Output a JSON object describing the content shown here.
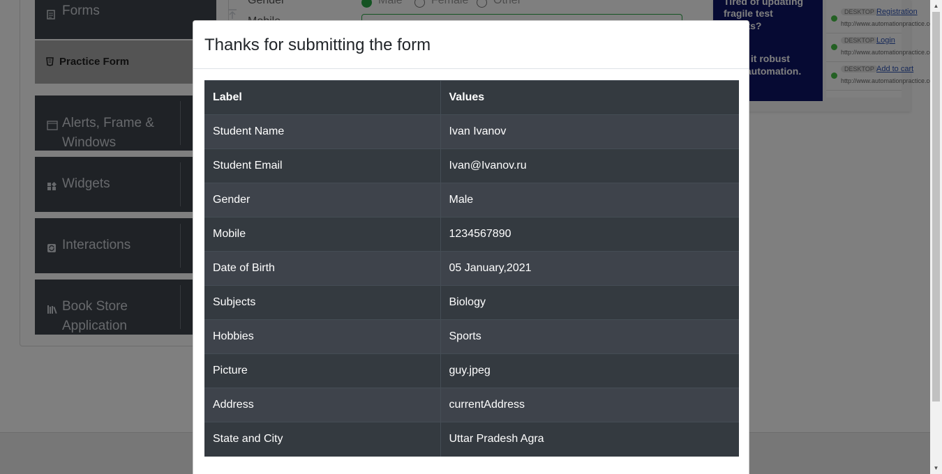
{
  "sidebar": {
    "forms_label": "Forms",
    "practice_label": "Practice Form",
    "alerts_label": "Alerts, Frame & Windows",
    "widgets_label": "Widgets",
    "interactions_label": "Interactions",
    "bookstore_label": "Book Store Application"
  },
  "form_bg": {
    "gender_label": "Gender",
    "mobile_label": "Mobile",
    "gender_options": [
      "Male",
      "Female",
      "Other"
    ]
  },
  "ad": {
    "text_lines": [
      "Tired of updating",
      "fragile test",
      "scripts?",
      "Make it robust",
      "with automation."
    ],
    "items": [
      {
        "tag": "DESKTOP",
        "link": "Registration",
        "url": "http://www.automationpractice.com"
      },
      {
        "tag": "DESKTOP",
        "link": "Login",
        "url": "http://www.automationpractice.com"
      },
      {
        "tag": "DESKTOP",
        "link": "Add to cart",
        "url": "http://www.automationpractice.com"
      }
    ]
  },
  "modal": {
    "title": "Thanks for submitting the form",
    "header": {
      "label": "Label",
      "value": "Values"
    },
    "rows": [
      {
        "label": "Student Name",
        "value": "Ivan Ivanov"
      },
      {
        "label": "Student Email",
        "value": "Ivan@Ivanov.ru"
      },
      {
        "label": "Gender",
        "value": "Male"
      },
      {
        "label": "Mobile",
        "value": "1234567890"
      },
      {
        "label": "Date of Birth",
        "value": "05 January,2021"
      },
      {
        "label": "Subjects",
        "value": "Biology"
      },
      {
        "label": "Hobbies",
        "value": "Sports"
      },
      {
        "label": "Picture",
        "value": "guy.jpeg"
      },
      {
        "label": "Address",
        "value": "currentAddress"
      },
      {
        "label": "State and City",
        "value": "Uttar Pradesh Agra"
      }
    ]
  },
  "colors": {
    "table_dark": "#343a40",
    "table_stripe": "#3e434b",
    "sidebar_bg": "#3f444d",
    "practice_active": "#a9a9a9",
    "radio_checked": "#28a745",
    "ad_bg": "#0d1566"
  }
}
